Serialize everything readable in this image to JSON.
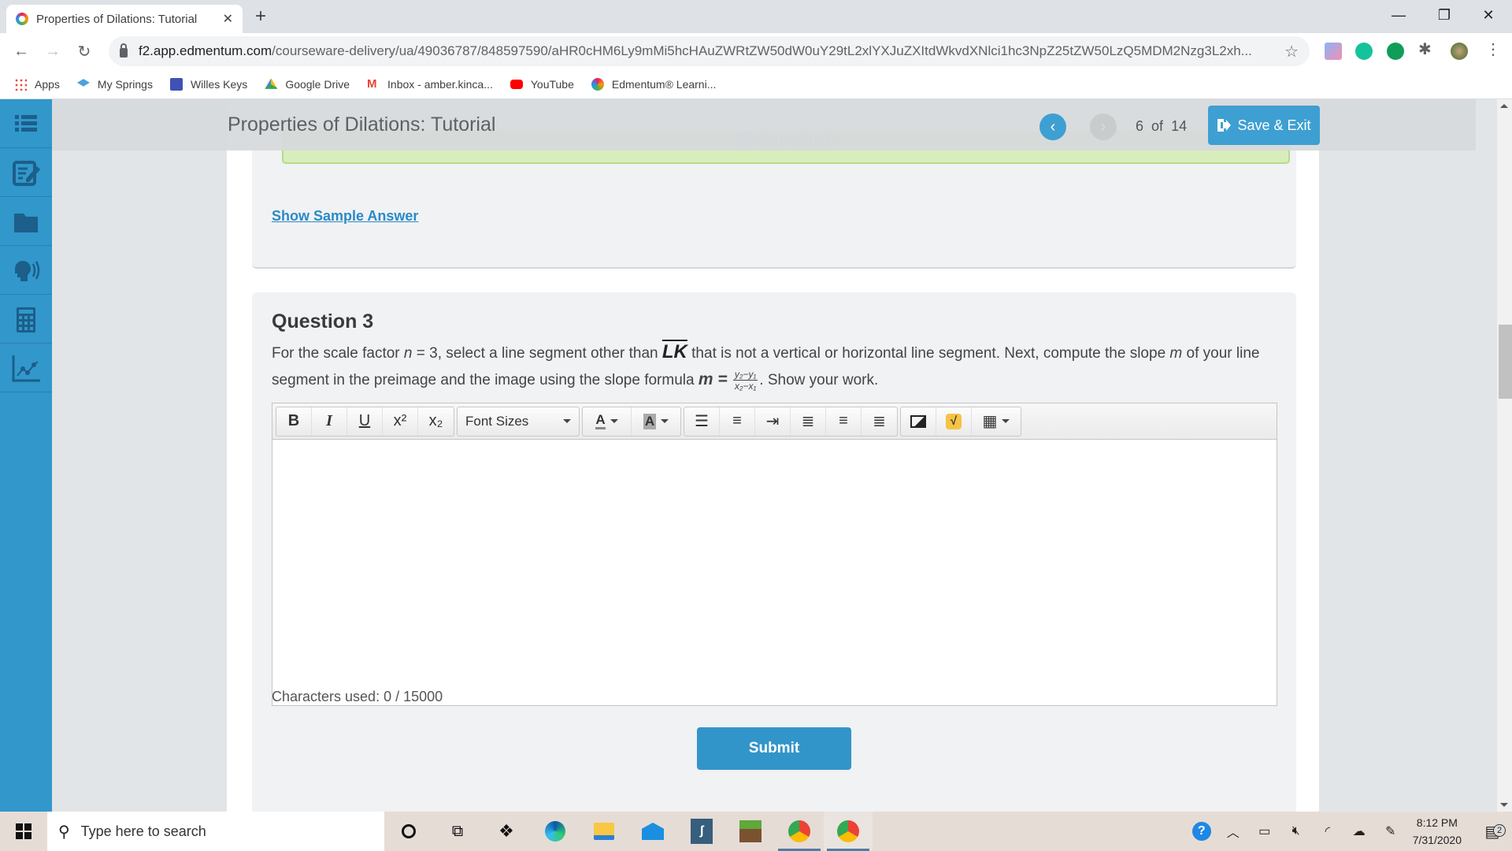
{
  "browser": {
    "tab_title": "Properties of Dilations: Tutorial",
    "url_host": "f2.app.edmentum.com",
    "url_path": "/courseware-delivery/ua/49036787/848597590/aHR0cHM6Ly9mMi5hcHAuZWRtZW50dW0uY29tL2xlYXJuZXItdWkvdXNlci1hc3NpZ25tZW50LzQ5MDM2Nzg3L2xh...",
    "bookmarks": [
      {
        "label": "Apps",
        "icon": "apps-grid-icon"
      },
      {
        "label": "My Springs",
        "icon": "graduation-cap-icon"
      },
      {
        "label": "Willes Keys",
        "icon": "form-icon"
      },
      {
        "label": "Google Drive",
        "icon": "google-drive-icon"
      },
      {
        "label": "Inbox - amber.kinca...",
        "icon": "gmail-icon"
      },
      {
        "label": "YouTube",
        "icon": "youtube-icon"
      },
      {
        "label": "Edmentum® Learni...",
        "icon": "edmentum-icon"
      }
    ]
  },
  "app": {
    "lesson_title": "Properties of Dilations: Tutorial",
    "current_page": "6",
    "of_label": "of",
    "total_pages": "14",
    "save_exit_label": "Save & Exit",
    "submitted_label": "Submitted!",
    "sidebar_items": [
      "table-of-contents",
      "notes",
      "folder",
      "text-to-speech",
      "calculator",
      "graphing"
    ],
    "colors": {
      "accent": "#3297cb",
      "button": "#3295c9",
      "submitted_bg": "#d8edbc"
    }
  },
  "previous": {
    "show_sample_label": "Show Sample Answer"
  },
  "question": {
    "heading": "Question 3",
    "text_part1": "For the scale factor ",
    "var_n": "n",
    "text_part2": " = 3, select a line segment other than ",
    "segment": "LK",
    "text_part3": " that is not a vertical or horizontal line segment. Next, compute the slope ",
    "var_m": "m",
    "text_part4": " of your line segment in the preimage and the image using the slope formula ",
    "formula_lhs": "m =",
    "formula_num": "y₂−y₁",
    "formula_den": "x₂−x₁",
    "text_part5": ". Show your work."
  },
  "editor": {
    "font_sizes_label": "Font Sizes",
    "value": "",
    "char_count_label": "Characters used: 0 / 15000"
  },
  "submit_label": "Submit",
  "taskbar": {
    "search_placeholder": "Type here to search",
    "time": "8:12 PM",
    "date": "7/31/2020",
    "notification_count": "2"
  }
}
